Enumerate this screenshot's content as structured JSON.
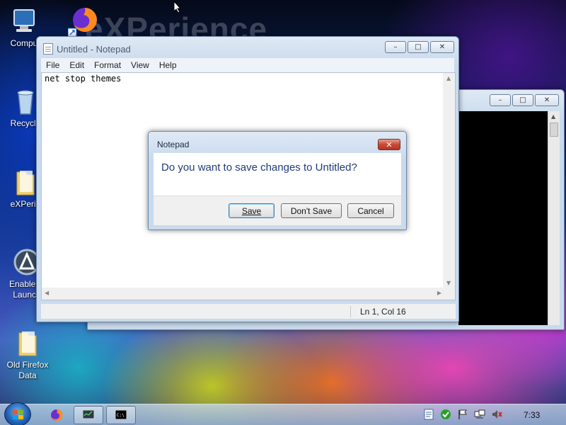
{
  "desktop": {
    "watermark": "eXPerience",
    "icons": [
      {
        "label": "Compu"
      },
      {
        "label": "Recycle"
      },
      {
        "label": "eXPerie"
      },
      {
        "label": "Enable Q",
        "label2": "Launch"
      },
      {
        "label": "Old Firefox",
        "label2": "Data"
      }
    ]
  },
  "notepad": {
    "title": "Untitled - Notepad",
    "menu": [
      {
        "label": "File"
      },
      {
        "label": "Edit"
      },
      {
        "label": "Format"
      },
      {
        "label": "View"
      },
      {
        "label": "Help"
      }
    ],
    "content": "net stop themes",
    "status_position": "Ln 1, Col 16"
  },
  "dialog": {
    "title": "Notepad",
    "message": "Do you want to save changes to Untitled?",
    "buttons": {
      "save": "Save",
      "dont_save": "Don't Save",
      "cancel": "Cancel"
    }
  },
  "taskbar": {
    "clock": "7:33",
    "pinned": [
      "firefox-icon",
      "task-manager-icon",
      "cmd-icon"
    ],
    "tray": [
      "notepad-tray-icon",
      "security-icon",
      "flag-icon",
      "network-icon",
      "volume-muted-icon"
    ]
  },
  "colors": {
    "dialog_message": "#1f3b7a",
    "close_button": "#c74a35",
    "taskbar": "#a8c2e0"
  }
}
